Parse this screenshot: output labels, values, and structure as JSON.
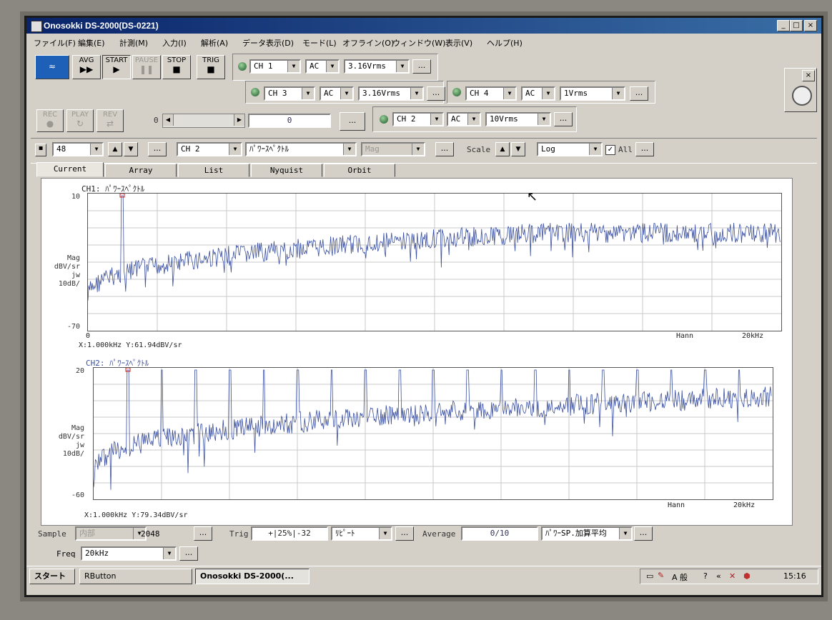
{
  "window": {
    "title": "Onosokki DS-2000(DS-0221)",
    "controls": {
      "minimize": "_",
      "maximize": "□",
      "close": "×"
    }
  },
  "menu": [
    "ファイル(F)",
    "編集(E)",
    "計測(M)",
    "入力(I)",
    "解析(A)",
    "データ表示(D)",
    "モード(L)",
    "オフライン(O)",
    "ウィンドウ(W)",
    "表示(V)",
    "ヘルプ(H)"
  ],
  "transport": {
    "avg": "AVG",
    "start": "START",
    "pause": "PAUSE",
    "stop": "STOP",
    "trig": "TRIG",
    "rec": "REC",
    "play": "PLAY",
    "rev": "REV"
  },
  "inputs": {
    "ch1": {
      "channel": "CH 1",
      "coupling": "AC",
      "range": "3.16Vrms"
    },
    "ch3": {
      "channel": "CH 3",
      "coupling": "AC",
      "range": "3.16Vrms"
    },
    "ch4": {
      "channel": "CH 4",
      "coupling": "AC",
      "range": "1Vrms"
    },
    "ch2": {
      "channel": "CH 2",
      "coupling": "AC",
      "range": "10Vrms"
    }
  },
  "playback": {
    "position_label": "0",
    "counter": "0",
    "more": "..."
  },
  "view": {
    "number": "48",
    "channel": "CH 2",
    "function": "ﾊﾟﾜｰｽﾍﾟｸﾄﾙ",
    "mag": "Mag",
    "scale_label": "Scale",
    "scale": "Log",
    "all_label": "All",
    "all_checked": "✓"
  },
  "tabs": [
    "Current",
    "Array",
    "List",
    "Nyquist",
    "Orbit"
  ],
  "graphs": {
    "ch1": {
      "title": "CH1: ﾊﾟﾜｰｽﾍﾟｸﾄﾙ",
      "ytop": "10",
      "ybottom": "-70",
      "yunit1": "Mag",
      "yunit2": "dBV/sr",
      "yunit3": "jw",
      "yunit4": "10dB/",
      "xstart": "0",
      "window": "Hann",
      "xend": "20kHz",
      "cursor": "X:1.000kHz Y:61.94dBV/sr"
    },
    "ch2": {
      "title": "CH2: ﾊﾟﾜｰｽﾍﾟｸﾄﾙ",
      "ytop": "20",
      "ybottom": "-60",
      "yunit1": "Mag",
      "yunit2": "dBV/sr",
      "yunit3": "jw",
      "yunit4": "10dB/",
      "window": "Hann",
      "xend": "20kHz",
      "cursor": "X:1.000kHz Y:79.34dBV/sr"
    }
  },
  "bottom": {
    "sample_label": "Sample",
    "sample_source": "内部",
    "sample_count": "2048",
    "trig_label": "Trig",
    "trig_value": "+|25%|-32",
    "trig_mode": "ﾘﾋﾟｰﾄ",
    "average_label": "Average",
    "average_value": "0/10",
    "average_mode": "ﾊﾟﾜｰSP.加算平均",
    "freq_label": "Freq",
    "freq_value": "20kHz"
  },
  "taskbar": {
    "start": "スタート",
    "item1": "RButton",
    "item2": "Onosokki DS-2000(...",
    "ime": "A 般",
    "time": "15:16"
  },
  "colors": {
    "trace": "#3a4fa0",
    "grid": "#c8c8c8",
    "titlebar": "#0a246a"
  }
}
